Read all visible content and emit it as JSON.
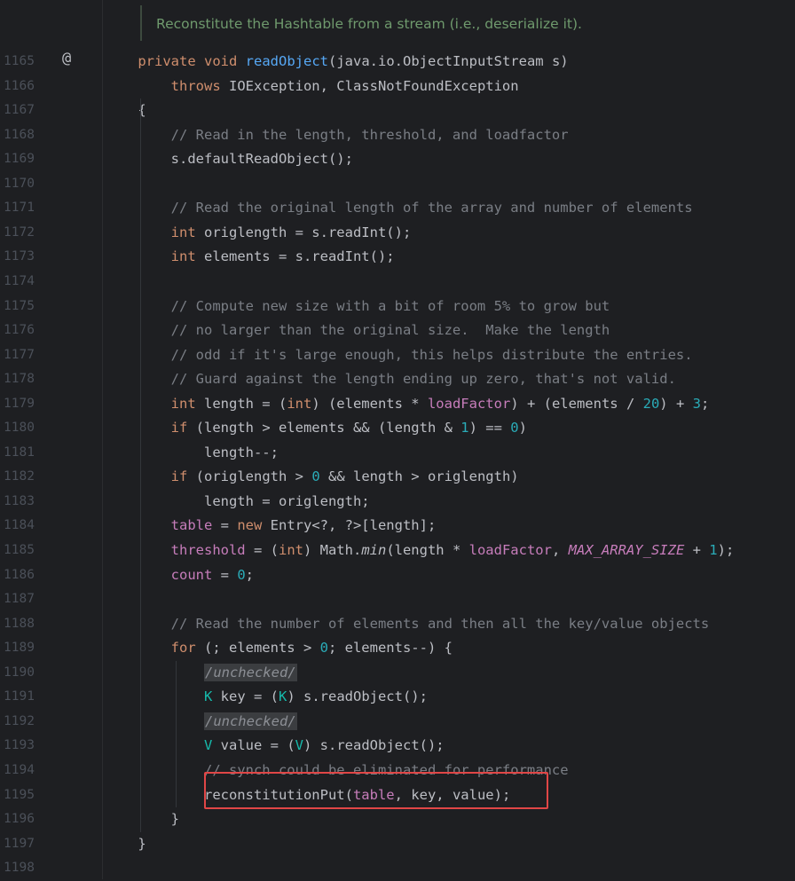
{
  "doc_comment": "Reconstitute the Hashtable from a stream (i.e., deserialize it).",
  "gutter_marker": "@",
  "lines": [
    {
      "n": "1165",
      "t": "    private void readObject(java.io.ObjectInputStream s)"
    },
    {
      "n": "1166",
      "t": "        throws IOException, ClassNotFoundException"
    },
    {
      "n": "1167",
      "t": "    {"
    },
    {
      "n": "1168",
      "t": "        // Read in the length, threshold, and loadfactor"
    },
    {
      "n": "1169",
      "t": "        s.defaultReadObject();"
    },
    {
      "n": "1170",
      "t": ""
    },
    {
      "n": "1171",
      "t": "        // Read the original length of the array and number of elements"
    },
    {
      "n": "1172",
      "t": "        int origlength = s.readInt();"
    },
    {
      "n": "1173",
      "t": "        int elements = s.readInt();"
    },
    {
      "n": "1174",
      "t": ""
    },
    {
      "n": "1175",
      "t": "        // Compute new size with a bit of room 5% to grow but"
    },
    {
      "n": "1176",
      "t": "        // no larger than the original size.  Make the length"
    },
    {
      "n": "1177",
      "t": "        // odd if it's large enough, this helps distribute the entries."
    },
    {
      "n": "1178",
      "t": "        // Guard against the length ending up zero, that's not valid."
    },
    {
      "n": "1179",
      "t": "        int length = (int) (elements * loadFactor) + (elements / 20) + 3;"
    },
    {
      "n": "1180",
      "t": "        if (length > elements && (length & 1) == 0)"
    },
    {
      "n": "1181",
      "t": "            length--;"
    },
    {
      "n": "1182",
      "t": "        if (origlength > 0 && length > origlength)"
    },
    {
      "n": "1183",
      "t": "            length = origlength;"
    },
    {
      "n": "1184",
      "t": "        table = new Entry<?, ?>[length];"
    },
    {
      "n": "1185",
      "t": "        threshold = (int) Math.min(length * loadFactor, MAX_ARRAY_SIZE + 1);"
    },
    {
      "n": "1186",
      "t": "        count = 0;"
    },
    {
      "n": "1187",
      "t": ""
    },
    {
      "n": "1188",
      "t": "        // Read the number of elements and then all the key/value objects"
    },
    {
      "n": "1189",
      "t": "        for (; elements > 0; elements--) {"
    },
    {
      "n": "1190",
      "t": "            /unchecked/"
    },
    {
      "n": "1191",
      "t": "            K key = (K) s.readObject();"
    },
    {
      "n": "1192",
      "t": "            /unchecked/"
    },
    {
      "n": "1193",
      "t": "            V value = (V) s.readObject();"
    },
    {
      "n": "1194",
      "t": "            // synch could be eliminated for performance"
    },
    {
      "n": "1195",
      "t": "            reconstitutionPut(table, key, value);"
    },
    {
      "n": "1196",
      "t": "        }"
    },
    {
      "n": "1197",
      "t": "    }"
    },
    {
      "n": "1198",
      "t": ""
    }
  ],
  "highlighted_line": "1195",
  "colors": {
    "background": "#1e1f22",
    "keyword": "#cf8e6d",
    "method": "#56a8f5",
    "comment": "#7a7e85",
    "number": "#2aacb8",
    "field": "#c77dbb",
    "highlight_box": "#e04646"
  }
}
